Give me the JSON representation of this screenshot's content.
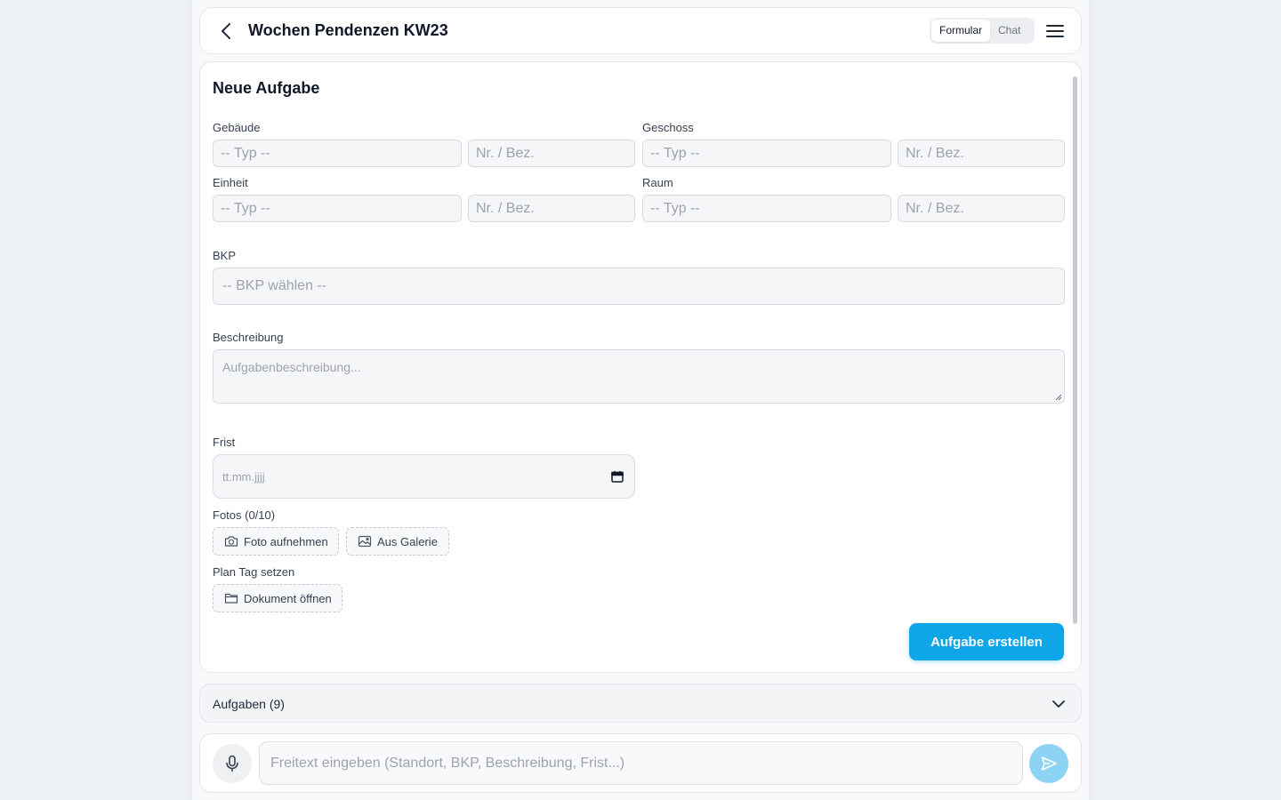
{
  "header": {
    "title": "Wochen Pendenzen KW23",
    "tabs": [
      {
        "label": "Formular",
        "active": true
      },
      {
        "label": "Chat",
        "active": false
      }
    ]
  },
  "form": {
    "title": "Neue Aufgabe",
    "gebaeude": {
      "label": "Gebäude",
      "type_placeholder": "-- Typ --",
      "nr_placeholder": "Nr. / Bez."
    },
    "geschoss": {
      "label": "Geschoss",
      "type_placeholder": "-- Typ --",
      "nr_placeholder": "Nr. / Bez."
    },
    "einheit": {
      "label": "Einheit",
      "type_placeholder": "-- Typ --",
      "nr_placeholder": "Nr. / Bez."
    },
    "raum": {
      "label": "Raum",
      "type_placeholder": "-- Typ --",
      "nr_placeholder": "Nr. / Bez."
    },
    "bkp": {
      "label": "BKP",
      "placeholder": "-- BKP wählen --"
    },
    "beschreibung": {
      "label": "Beschreibung",
      "placeholder": "Aufgabenbeschreibung..."
    },
    "frist": {
      "label": "Frist",
      "placeholder": "tt.mm.jjjj"
    },
    "fotos": {
      "label": "Fotos (0/10)",
      "take_photo": "Foto aufnehmen",
      "gallery": "Aus Galerie"
    },
    "plan": {
      "label": "Plan Tag setzen",
      "open_doc": "Dokument öffnen"
    },
    "submit_label": "Aufgabe erstellen"
  },
  "tasks": {
    "label": "Aufgaben (9)"
  },
  "chat": {
    "placeholder": "Freitext eingeben (Standort, BKP, Beschreibung, Frist...)"
  },
  "colors": {
    "accent": "#0ea5e9",
    "send_disabled": "#8dd3f3"
  },
  "icons": [
    "back-icon",
    "menu-icon",
    "camera-icon",
    "image-icon",
    "folder-icon",
    "calendar-icon",
    "chevron-down-icon",
    "mic-icon",
    "send-icon"
  ]
}
